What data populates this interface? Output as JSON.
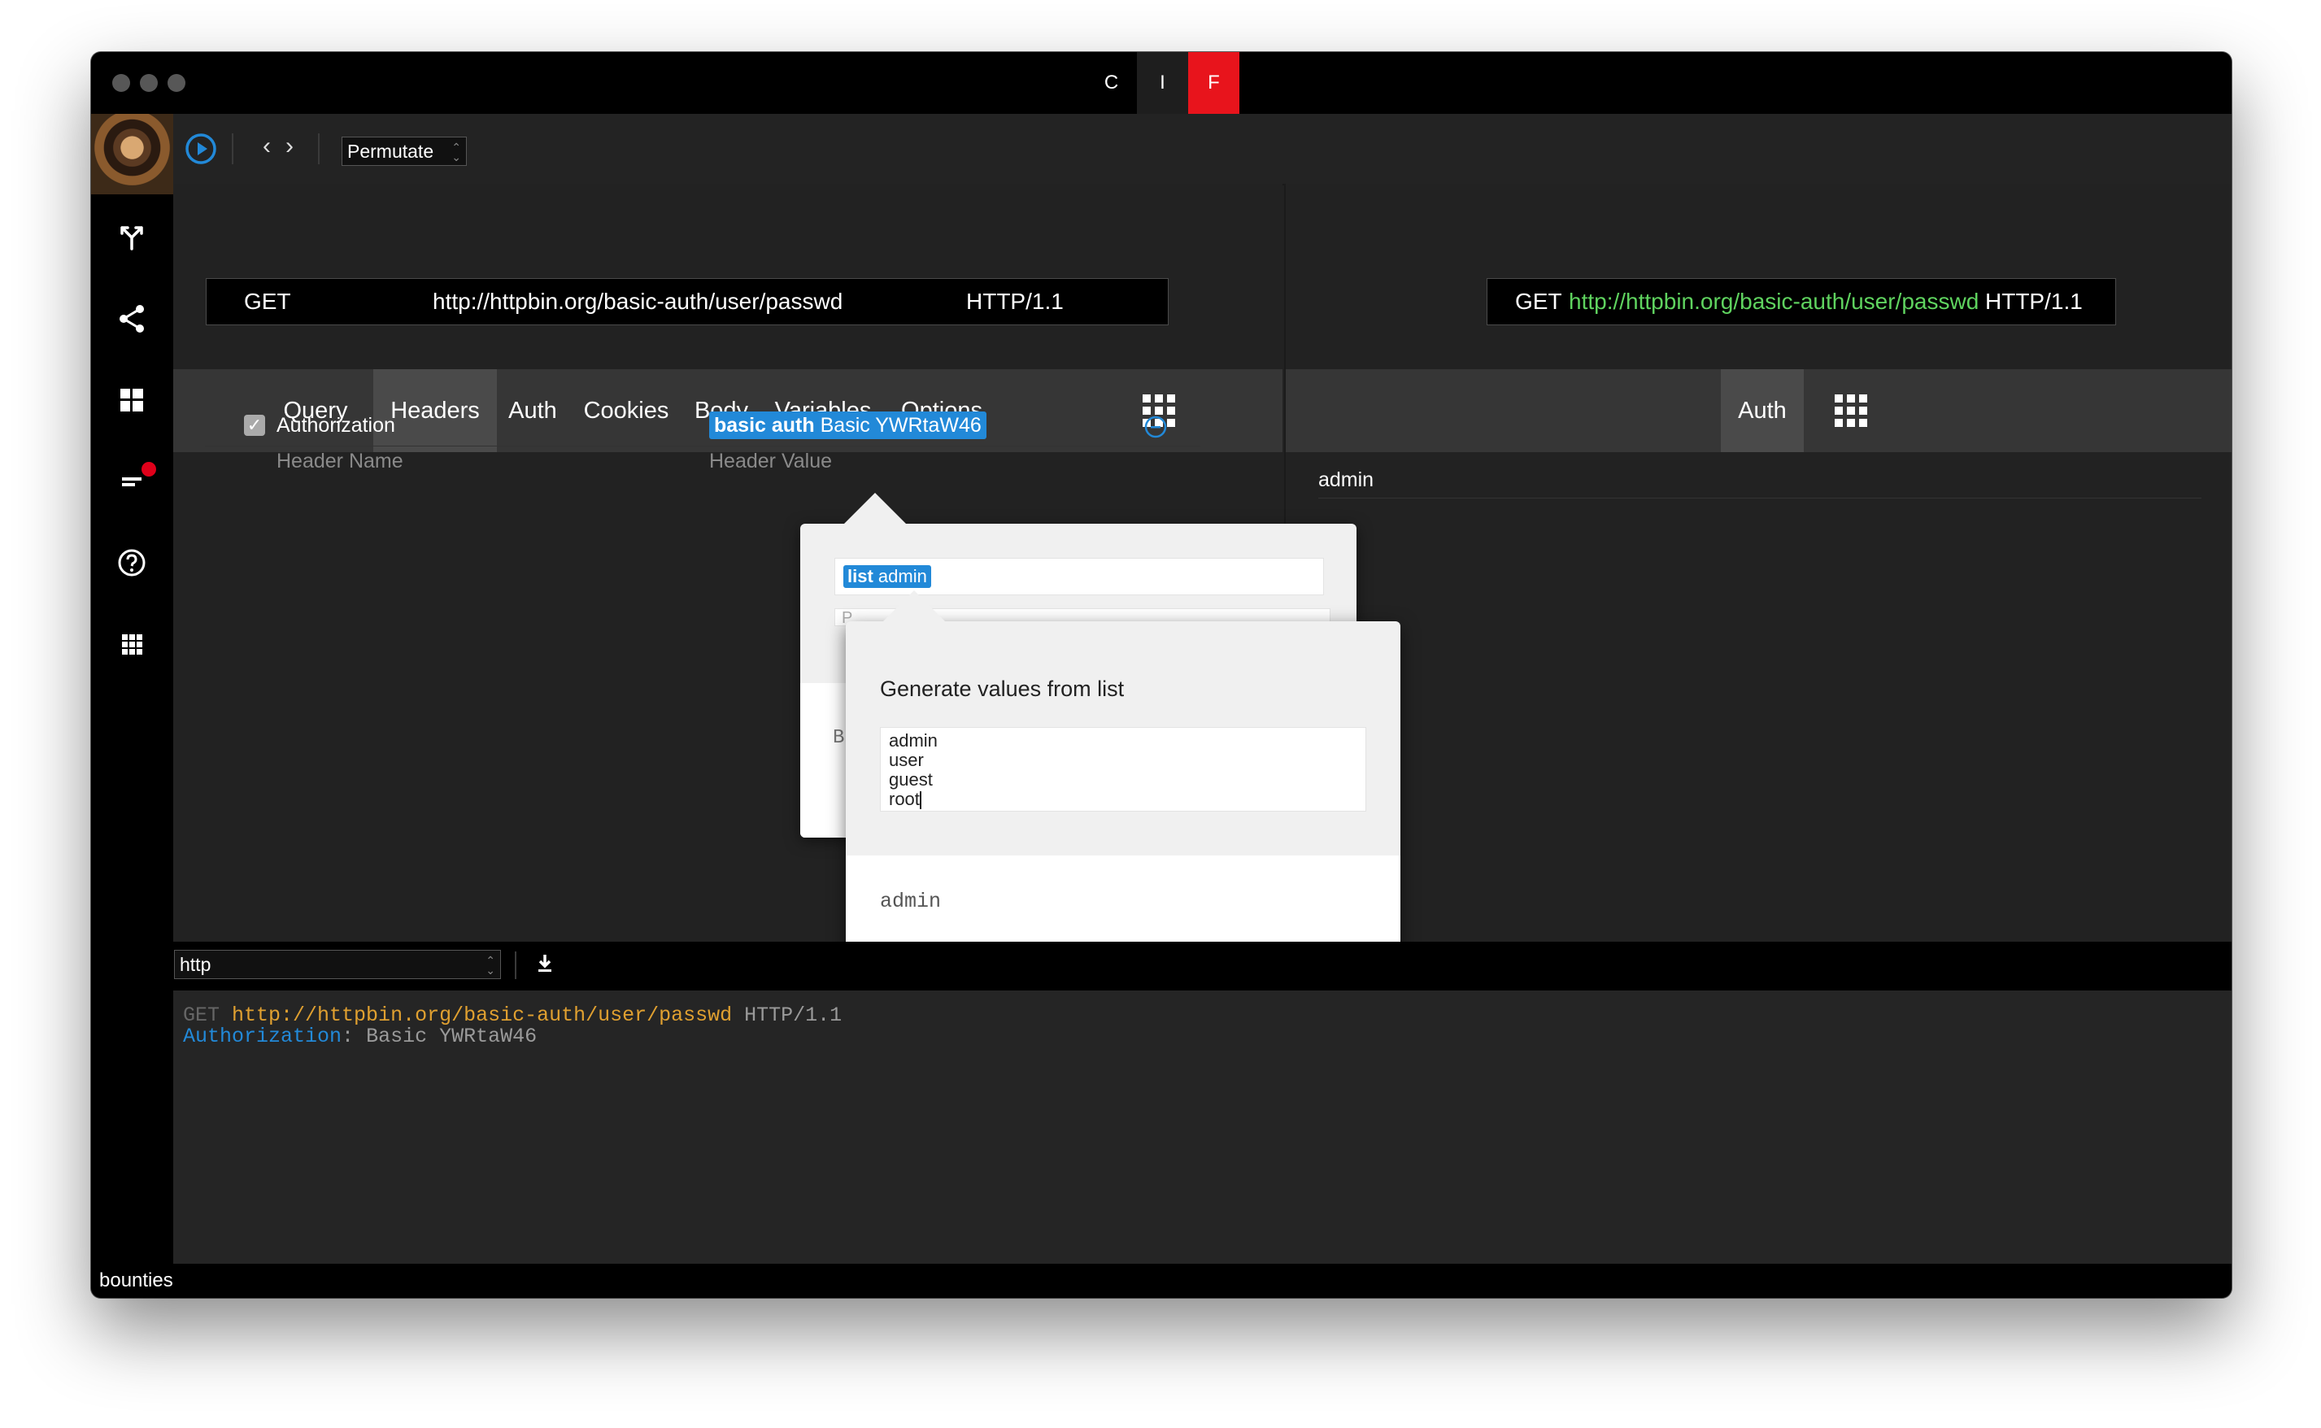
{
  "window": {
    "mode_buttons": [
      {
        "label": "C",
        "color": "#000000"
      },
      {
        "label": "I",
        "color": "#1e1e1e"
      },
      {
        "label": "F",
        "color": "#e8141c"
      }
    ]
  },
  "sidebar": {
    "items": [
      {
        "icon": "branch-icon"
      },
      {
        "icon": "share-icon"
      },
      {
        "icon": "dashboard-icon",
        "has_notification": true
      },
      {
        "icon": "lines-icon"
      },
      {
        "icon": "help-icon"
      },
      {
        "icon": "apps-icon"
      }
    ]
  },
  "toolbar": {
    "prev_label": "‹",
    "next_label": "›",
    "mode_select": "Permutate"
  },
  "request_left": {
    "method": "GET",
    "url": "http://httpbin.org/basic-auth/user/passwd",
    "version": "HTTP/1.1"
  },
  "request_right": {
    "method": "GET",
    "url": "http://httpbin.org/basic-auth/user/passwd",
    "version": "HTTP/1.1",
    "url_color": "#5fd35f"
  },
  "tabs_left": [
    "Query",
    "Headers",
    "Auth",
    "Cookies",
    "Body",
    "Variables",
    "Options"
  ],
  "active_tab_left": "Headers",
  "tabs_right": [
    "Auth"
  ],
  "headers": {
    "row": {
      "enabled": true,
      "name": "Authorization",
      "token_keyword": "basic auth",
      "token_value": "Basic YWRtaW46"
    },
    "name_placeholder": "Header Name",
    "value_placeholder": "Header Value"
  },
  "right_panel": {
    "value": "admin"
  },
  "popover1": {
    "token_keyword": "list",
    "token_value": "admin",
    "hidden_letter_1": "P",
    "hidden_letter_2": "B"
  },
  "popover2": {
    "title": "Generate values from list",
    "list_items": [
      "admin",
      "user",
      "guest",
      "root"
    ],
    "preview": "admin",
    "nav": "‹ ›"
  },
  "console": {
    "format_select": "http",
    "line1_method": "GET",
    "line1_url": "http://httpbin.org/basic-auth/user/passwd",
    "line1_version": "HTTP/1.1",
    "line2_key": "Authorization",
    "line2_value": "Basic YWRtaW46",
    "colors": {
      "method": "#666666",
      "url": "#e0a030",
      "key": "#2289d8",
      "value": "#9a9a9a"
    }
  },
  "status_bar": {
    "text": "bounties"
  }
}
